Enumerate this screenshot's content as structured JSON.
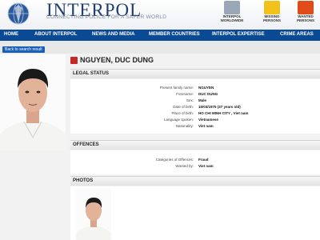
{
  "header": {
    "brand": "INTERPOL",
    "tagline": "CONNECTING POLICE FOR A SAFER WORLD",
    "buttons": [
      {
        "label_line1": "INTERPOL",
        "label_line2": "WORLDWIDE",
        "icon": "interpol-worldwide-icon",
        "color": "#9aa7b8"
      },
      {
        "label_line1": "MISSING",
        "label_line2": "PERSONS",
        "icon": "missing-persons-icon",
        "color": "#f2c21b"
      },
      {
        "label_line1": "WANTED",
        "label_line2": "PERSONS",
        "icon": "wanted-persons-icon",
        "color": "#e04b1a"
      }
    ]
  },
  "nav": {
    "items": [
      "HOME",
      "ABOUT INTERPOL",
      "NEWS AND MEDIA",
      "MEMBER COUNTRIES",
      "INTERPOL EXPERTISE",
      "CRIME AREAS"
    ]
  },
  "back_button": "Back to search result",
  "person": {
    "name": "NGUYEN, DUC DUNG"
  },
  "legal_status": {
    "title": "LEGAL STATUS",
    "rows": [
      {
        "k": "Present family name:",
        "v": "NGUYEN"
      },
      {
        "k": "Forename:",
        "v": "DUC DUNG"
      },
      {
        "k": "Sex:",
        "v": "Male"
      },
      {
        "k": "Date of birth:",
        "v": "15/03/1975 (37 years old)"
      },
      {
        "k": "Place of birth:",
        "v": "HO CHI MINH CITY , Viet nam"
      },
      {
        "k": "Language spoken:",
        "v": "Vietnamese"
      },
      {
        "k": "Nationality:",
        "v": "Viet nam"
      }
    ]
  },
  "offences": {
    "title": "OFFENCES",
    "rows": [
      {
        "k": "Categories of Offences:",
        "v": "Fraud"
      },
      {
        "k": "Wanted by:",
        "v": "Viet nam"
      }
    ]
  },
  "photos": {
    "title": "PHOTOS"
  },
  "colors": {
    "nav": "#0a4a94",
    "brand": "#1f3d6e",
    "accent_red": "#c62828"
  }
}
